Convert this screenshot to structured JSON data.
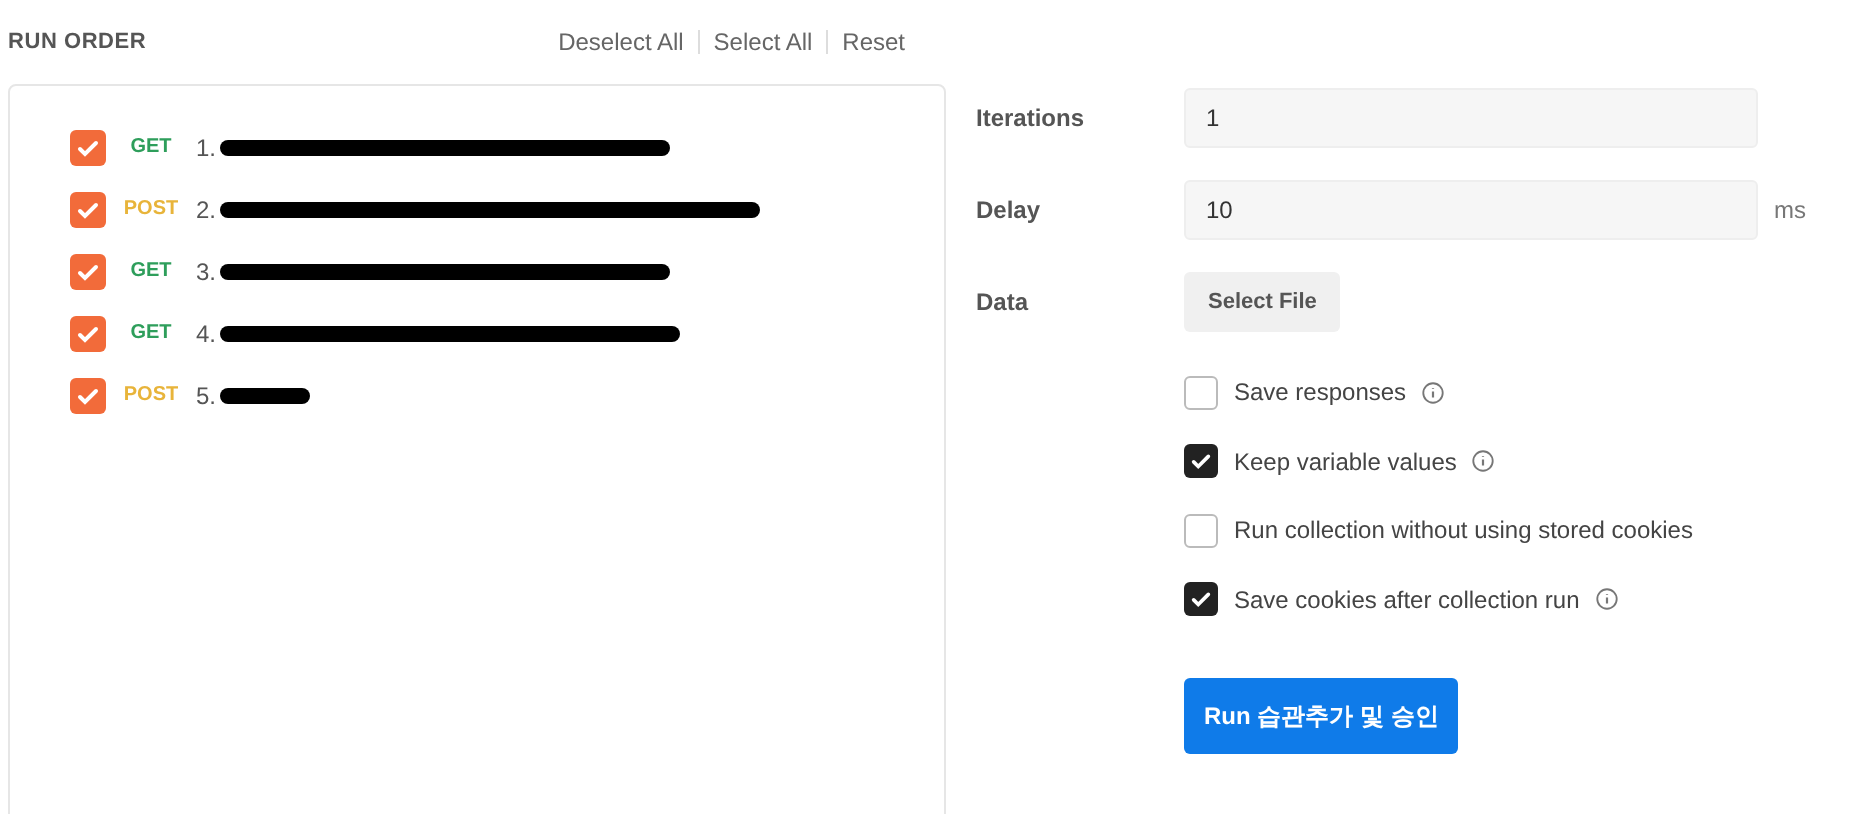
{
  "header": {
    "title": "RUN ORDER",
    "actions": [
      "Deselect All",
      "Select All",
      "Reset"
    ]
  },
  "requests": [
    {
      "method": "GET",
      "name": "1.",
      "checked": true
    },
    {
      "method": "POST",
      "name": "2.",
      "checked": true
    },
    {
      "method": "GET",
      "name": "3.",
      "checked": true
    },
    {
      "method": "GET",
      "name": "4.",
      "checked": true
    },
    {
      "method": "POST",
      "name": "5.",
      "checked": true
    }
  ],
  "settings": {
    "iterations": {
      "label": "Iterations",
      "value": "1"
    },
    "delay": {
      "label": "Delay",
      "value": "10",
      "unit": "ms"
    },
    "data": {
      "label": "Data",
      "button": "Select File"
    }
  },
  "options": [
    {
      "label": "Save responses",
      "checked": false,
      "info": true
    },
    {
      "label": "Keep variable values",
      "checked": true,
      "info": true
    },
    {
      "label": "Run collection without using stored cookies",
      "checked": false,
      "info": false
    },
    {
      "label": "Save cookies after collection run",
      "checked": true,
      "info": true
    }
  ],
  "run_button": "Run 습관추가 및 승인"
}
